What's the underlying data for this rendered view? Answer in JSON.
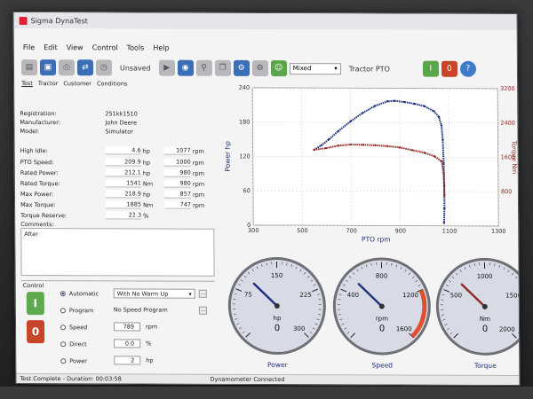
{
  "window": {
    "title": "Sigma DynaTest"
  },
  "menu": [
    "File",
    "Edit",
    "View",
    "Control",
    "Tools",
    "Help"
  ],
  "toolbar": {
    "status_text": "Unsaved",
    "mode_select": "Mixed",
    "source_label": "Tractor PTO",
    "start_label": "I",
    "stop_label": "0",
    "help_label": "?"
  },
  "tabs": [
    "Test",
    "Tractor",
    "Customer",
    "Conditions"
  ],
  "info": {
    "registration_label": "Registration:",
    "registration": "251kk1510",
    "manufacturer_label": "Manufacturer:",
    "manufacturer": "John Deere",
    "model_label": "Model:",
    "model": "Simulator"
  },
  "results": [
    {
      "label": "High Idle:",
      "v1": "4.6",
      "u1": "hp",
      "v2": "1077",
      "u2": "rpm"
    },
    {
      "label": "PTO Speed:",
      "v1": "209.9",
      "u1": "hp",
      "v2": "1000",
      "u2": "rpm"
    },
    {
      "label": "Rated Power:",
      "v1": "212.1",
      "u1": "hp",
      "v2": "980",
      "u2": "rpm"
    },
    {
      "label": "Rated Torque:",
      "v1": "1541",
      "u1": "Nm",
      "v2": "980",
      "u2": "rpm"
    },
    {
      "label": "Max Power:",
      "v1": "218.9",
      "u1": "hp",
      "v2": "857",
      "u2": "rpm"
    },
    {
      "label": "Max Torque:",
      "v1": "1885",
      "u1": "Nm",
      "v2": "747",
      "u2": "rpm"
    },
    {
      "label": "Torque Reserve:",
      "v1": "22.3",
      "u1": "%",
      "v2": "",
      "u2": ""
    }
  ],
  "comments": {
    "label": "Comments:",
    "text": "After"
  },
  "control": {
    "title": "Control",
    "start_label": "I",
    "stop_label": "0",
    "automatic_label": "Automatic",
    "automatic_select": "With No Warm Up",
    "program_label": "Program",
    "program_select": "No Speed Program",
    "speed_label": "Speed",
    "speed_value": "789",
    "speed_unit": "rpm",
    "direct_label": "Direct",
    "direct_value": "0.0",
    "direct_unit": "%",
    "power_label": "Power",
    "power_value": "2",
    "power_unit": "hp",
    "dots": "..."
  },
  "chart_data": {
    "type": "scatter",
    "xlabel": "PTO rpm",
    "ylabel": "Power hp",
    "ylabel_right": "Torque Nm",
    "xlim": [
      300,
      1300
    ],
    "ylim": [
      0,
      240
    ],
    "ylim_right": [
      0,
      3200
    ],
    "x_ticks": [
      300,
      500,
      700,
      900,
      1100,
      1300
    ],
    "y_ticks": [
      0,
      60,
      120,
      180,
      240
    ],
    "y_right_ticks": [
      800,
      1600,
      2400,
      3200
    ],
    "series": [
      {
        "color": "#1c2f7a",
        "axis": "left",
        "x": [
          550,
          580,
          610,
          650,
          700,
          750,
          800,
          850,
          880,
          920,
          960,
          1000,
          1040,
          1060,
          1070,
          1075,
          1078,
          1080,
          1080,
          1078
        ],
        "y": [
          132,
          140,
          150,
          165,
          182,
          197,
          209,
          217,
          218,
          216,
          213,
          209,
          200,
          190,
          175,
          150,
          110,
          70,
          30,
          5
        ]
      },
      {
        "color": "#8a2a22",
        "axis": "right",
        "x": [
          550,
          600,
          650,
          700,
          750,
          800,
          850,
          900,
          950,
          1000,
          1040,
          1070,
          1078,
          1080
        ],
        "y": [
          1760,
          1800,
          1860,
          1885,
          1880,
          1870,
          1850,
          1820,
          1760,
          1700,
          1620,
          1500,
          1200,
          700
        ]
      }
    ]
  },
  "gauges": [
    {
      "name": "Power",
      "unit": "hp",
      "value": "0",
      "min": 0,
      "max": 300,
      "ticks": [
        "75",
        "150",
        "225",
        "300"
      ],
      "reading": 0,
      "needle_color": "#1c2f7a"
    },
    {
      "name": "Speed",
      "unit": "rpm",
      "value": "0",
      "min": 0,
      "max": 1600,
      "ticks": [
        "400",
        "800",
        "1200",
        "1600"
      ],
      "reading": 0,
      "needle_color": "#1c2f7a"
    },
    {
      "name": "Torque",
      "unit": "Nm",
      "value": "0",
      "min": 0,
      "max": 2000,
      "ticks": [
        "500",
        "1000",
        "1500",
        "2000"
      ],
      "reading": 0,
      "needle_color": "#8a2a22"
    }
  ],
  "status": {
    "left": "Test Complete - Duration: 00:03:58",
    "center": "Dynamometer Connected"
  }
}
